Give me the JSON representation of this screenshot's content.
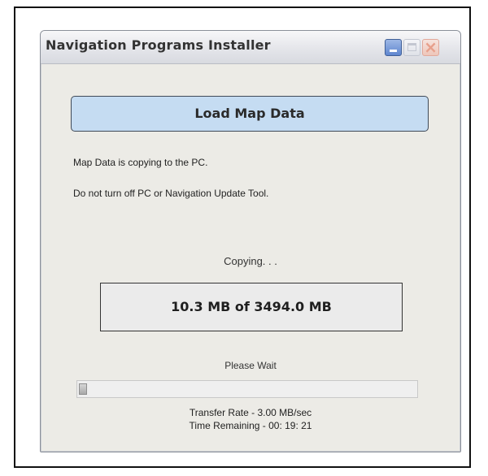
{
  "window": {
    "title": "Navigation Programs Installer",
    "controls": {
      "minimize_icon": "minimize-icon",
      "maximize_icon": "maximize-icon",
      "close_icon": "close-icon"
    }
  },
  "main": {
    "action_button_label": "Load Map Data",
    "messages": [
      "Map Data is copying to the PC.",
      "Do not turn off PC or Navigation Update Tool."
    ],
    "status_label": "Copying. . .",
    "progress_text": "10.3 MB of 3494.0 MB",
    "wait_label": "Please Wait",
    "progress_fraction": 0.003,
    "transfer_rate": "Transfer Rate - 3.00 MB/sec",
    "time_remaining": "Time Remaining - 00: 19: 21"
  },
  "colors": {
    "button_fill": "#c5dcf2",
    "window_bg": "#ecebe6"
  }
}
